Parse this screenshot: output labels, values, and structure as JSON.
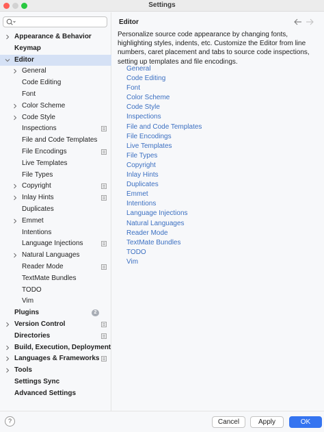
{
  "window": {
    "title": "Settings"
  },
  "search": {
    "value": "",
    "placeholder": ""
  },
  "tree": [
    {
      "label": "Appearance & Behavior",
      "level": 0,
      "bold": true,
      "chevron": "right"
    },
    {
      "label": "Keymap",
      "level": 0,
      "bold": true,
      "chevron": "none"
    },
    {
      "label": "Editor",
      "level": 0,
      "bold": true,
      "chevron": "down",
      "selected": true
    },
    {
      "label": "General",
      "level": 1,
      "bold": false,
      "chevron": "right"
    },
    {
      "label": "Code Editing",
      "level": 1,
      "bold": false,
      "chevron": "none"
    },
    {
      "label": "Font",
      "level": 1,
      "bold": false,
      "chevron": "none"
    },
    {
      "label": "Color Scheme",
      "level": 1,
      "bold": false,
      "chevron": "right"
    },
    {
      "label": "Code Style",
      "level": 1,
      "bold": false,
      "chevron": "right"
    },
    {
      "label": "Inspections",
      "level": 1,
      "bold": false,
      "chevron": "none",
      "page_icon": true
    },
    {
      "label": "File and Code Templates",
      "level": 1,
      "bold": false,
      "chevron": "none"
    },
    {
      "label": "File Encodings",
      "level": 1,
      "bold": false,
      "chevron": "none",
      "page_icon": true
    },
    {
      "label": "Live Templates",
      "level": 1,
      "bold": false,
      "chevron": "none"
    },
    {
      "label": "File Types",
      "level": 1,
      "bold": false,
      "chevron": "none"
    },
    {
      "label": "Copyright",
      "level": 1,
      "bold": false,
      "chevron": "right",
      "page_icon": true
    },
    {
      "label": "Inlay Hints",
      "level": 1,
      "bold": false,
      "chevron": "right",
      "page_icon": true
    },
    {
      "label": "Duplicates",
      "level": 1,
      "bold": false,
      "chevron": "none"
    },
    {
      "label": "Emmet",
      "level": 1,
      "bold": false,
      "chevron": "right"
    },
    {
      "label": "Intentions",
      "level": 1,
      "bold": false,
      "chevron": "none"
    },
    {
      "label": "Language Injections",
      "level": 1,
      "bold": false,
      "chevron": "none",
      "page_icon": true
    },
    {
      "label": "Natural Languages",
      "level": 1,
      "bold": false,
      "chevron": "right"
    },
    {
      "label": "Reader Mode",
      "level": 1,
      "bold": false,
      "chevron": "none",
      "page_icon": true
    },
    {
      "label": "TextMate Bundles",
      "level": 1,
      "bold": false,
      "chevron": "none"
    },
    {
      "label": "TODO",
      "level": 1,
      "bold": false,
      "chevron": "none"
    },
    {
      "label": "Vim",
      "level": 1,
      "bold": false,
      "chevron": "none"
    },
    {
      "label": "Plugins",
      "level": 0,
      "bold": true,
      "chevron": "none",
      "badge": "2"
    },
    {
      "label": "Version Control",
      "level": 0,
      "bold": true,
      "chevron": "right",
      "page_icon": true
    },
    {
      "label": "Directories",
      "level": 0,
      "bold": true,
      "chevron": "none",
      "page_icon": true
    },
    {
      "label": "Build, Execution, Deployment",
      "level": 0,
      "bold": true,
      "chevron": "right"
    },
    {
      "label": "Languages & Frameworks",
      "level": 0,
      "bold": true,
      "chevron": "right",
      "page_icon": true
    },
    {
      "label": "Tools",
      "level": 0,
      "bold": true,
      "chevron": "right"
    },
    {
      "label": "Settings Sync",
      "level": 0,
      "bold": true,
      "chevron": "none"
    },
    {
      "label": "Advanced Settings",
      "level": 0,
      "bold": true,
      "chevron": "none"
    }
  ],
  "content": {
    "title": "Editor",
    "description": "Personalize source code appearance by changing fonts, highlighting styles, indents, etc. Customize the Editor from line numbers, caret placement and tabs to source code inspections, setting up templates and file encodings.",
    "links": [
      "General",
      "Code Editing",
      "Font",
      "Color Scheme",
      "Code Style",
      "Inspections",
      "File and Code Templates",
      "File Encodings",
      "Live Templates",
      "File Types",
      "Copyright",
      "Inlay Hints",
      "Duplicates",
      "Emmet",
      "Intentions",
      "Language Injections",
      "Natural Languages",
      "Reader Mode",
      "TextMate Bundles",
      "TODO",
      "Vim"
    ]
  },
  "footer": {
    "help": "?",
    "cancel": "Cancel",
    "apply": "Apply",
    "ok": "OK"
  },
  "colors": {
    "accent": "#3574f0",
    "link": "#3b6fc1",
    "selection": "#d5e1f5"
  },
  "icons": {
    "search": "search-icon",
    "chevron_right": "chevron-right-icon",
    "chevron_down": "chevron-down-icon",
    "page": "page-icon",
    "back": "arrow-left-icon",
    "forward": "arrow-right-icon",
    "help": "help-icon"
  }
}
